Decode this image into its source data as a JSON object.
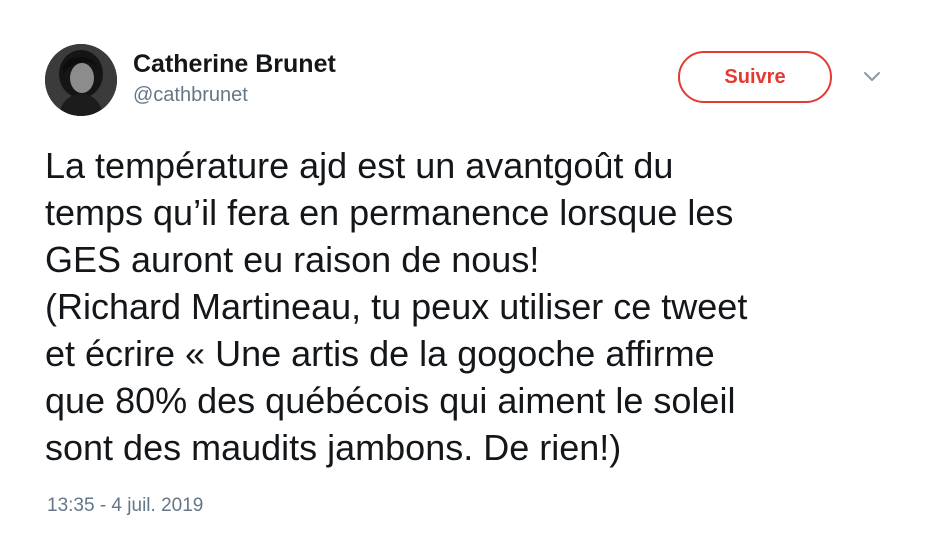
{
  "author": {
    "name": "Catherine Brunet",
    "handle": "@cathbrunet"
  },
  "follow_button": {
    "label": "Suivre"
  },
  "icons": {
    "menu": "chevron-down-icon",
    "avatar": "profile-photo"
  },
  "tweet": {
    "lines": [
      "La température ajd est un avantgoût du",
      "temps qu’il fera en permanence lorsque les",
      "GES auront eu raison de nous!",
      "(Richard Martineau, tu peux utiliser ce tweet",
      "et écrire « Une artis de la gogoche affirme",
      "que 80% des québécois qui aiment le soleil",
      "sont des maudits jambons. De rien!)"
    ],
    "timestamp": "13:35 - 4 juil. 2019"
  },
  "colors": {
    "text": "#14171a",
    "secondary": "#657786",
    "follow_accent": "#e33b33"
  }
}
